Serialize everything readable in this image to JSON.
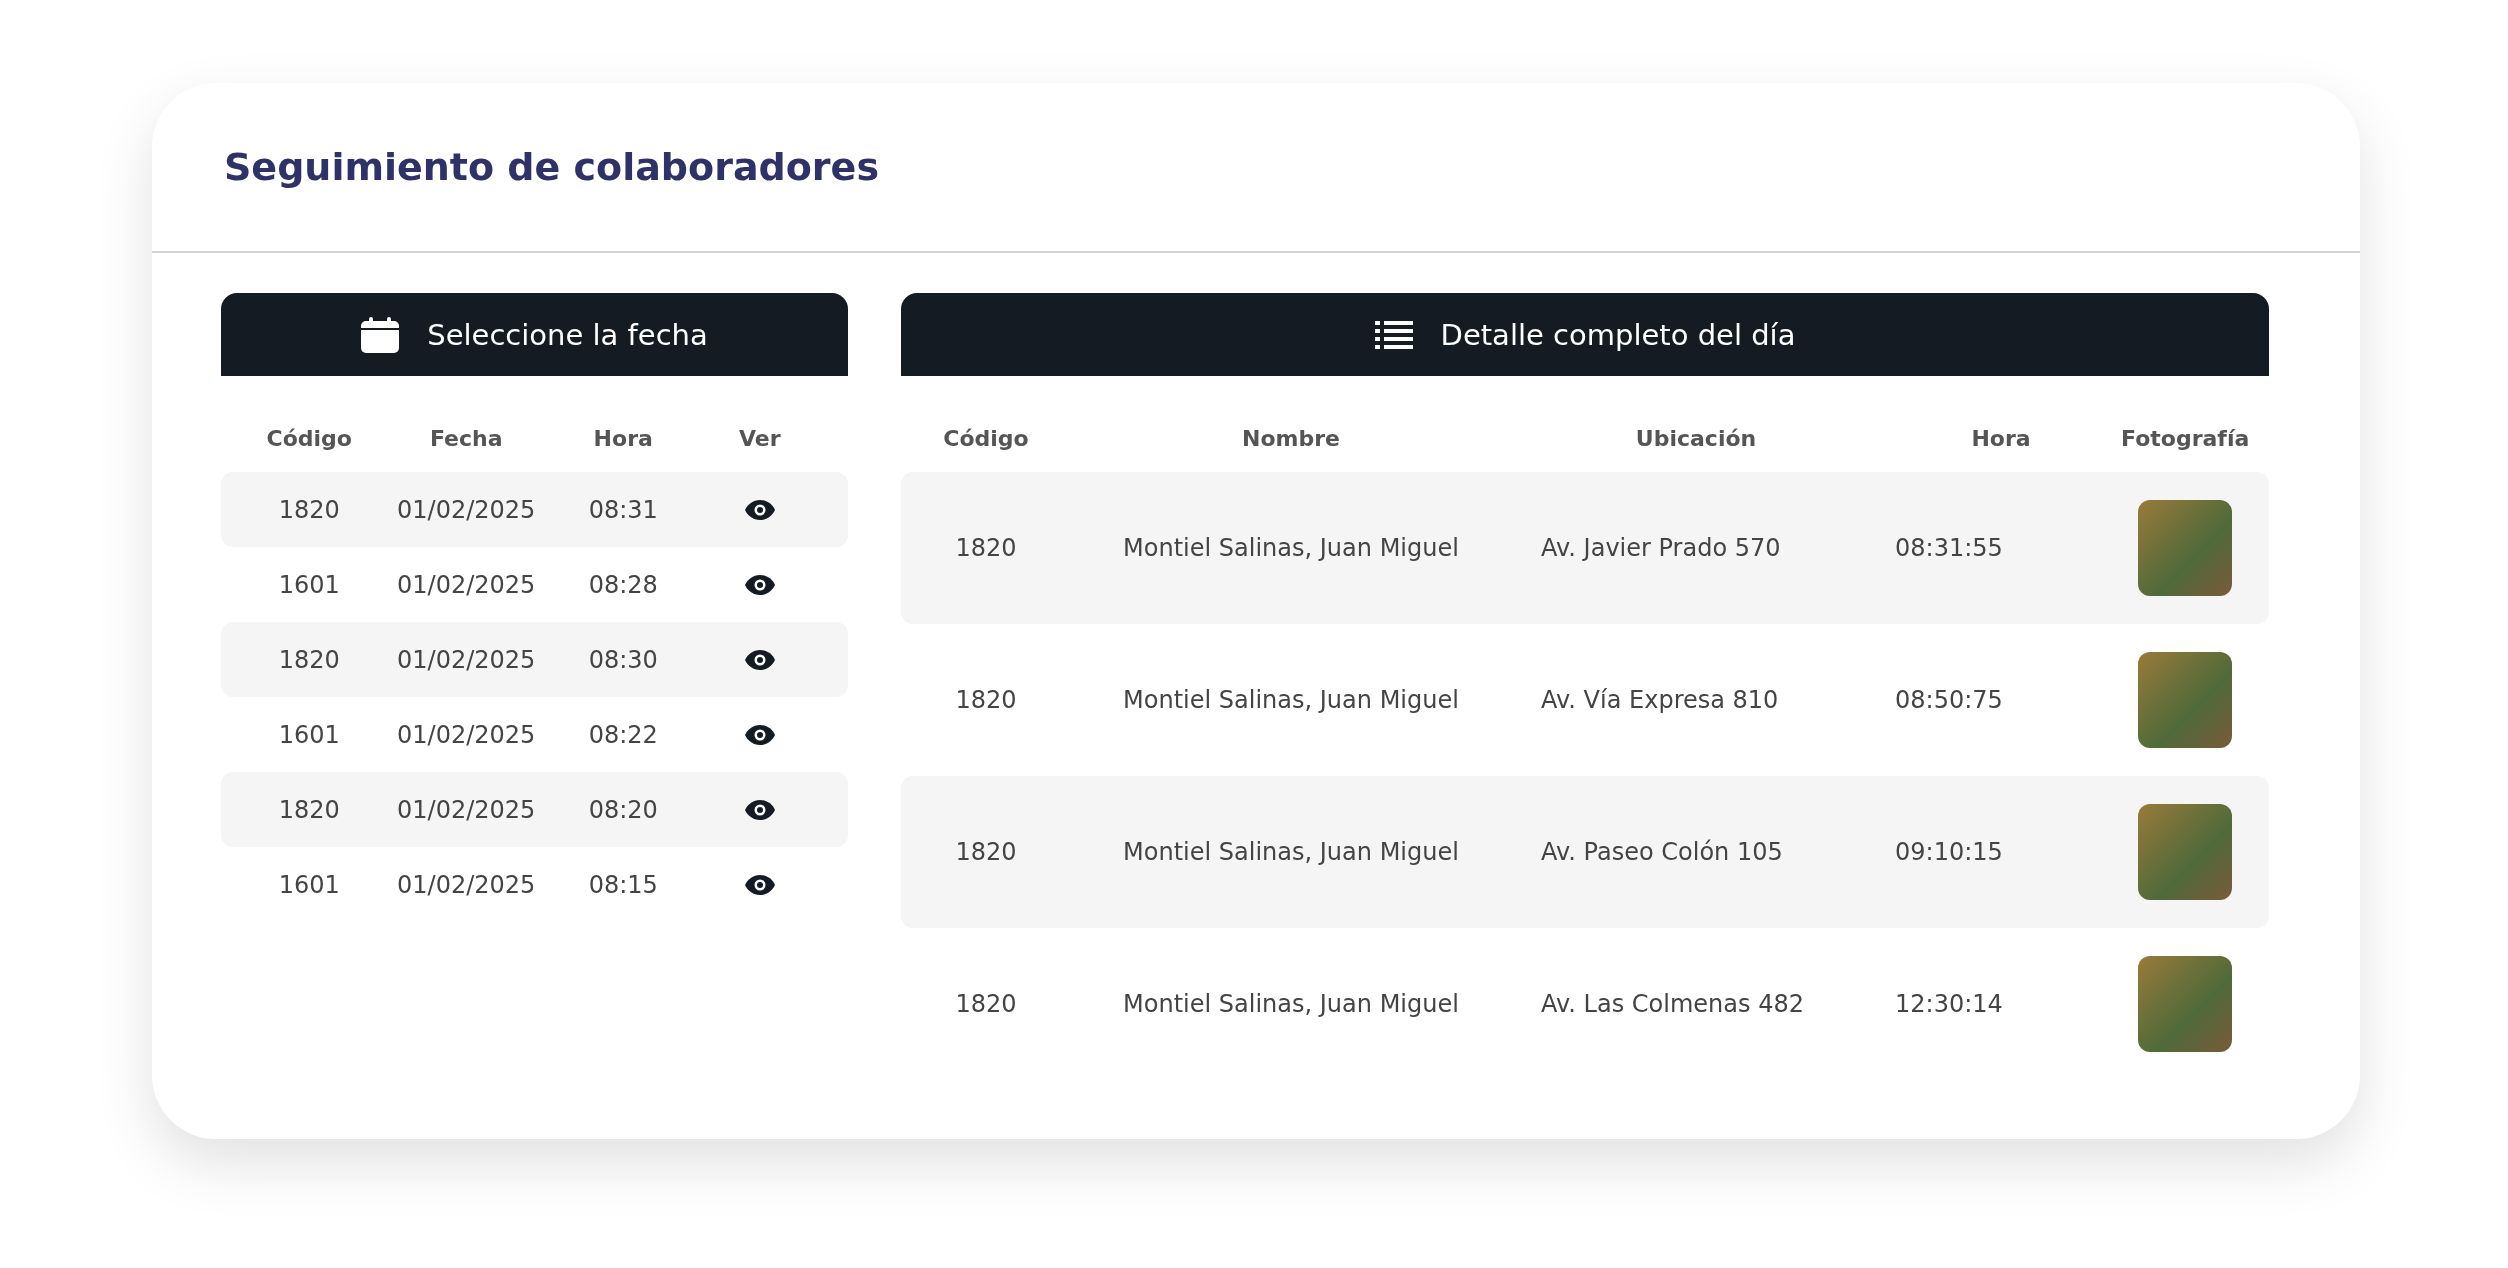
{
  "title": "Seguimiento de colaboradores",
  "date_panel": {
    "header": "Seleccione la fecha",
    "columns": [
      "Código",
      "Fecha",
      "Hora",
      "Ver"
    ],
    "rows": [
      {
        "code": "1820",
        "date": "01/02/2025",
        "time": "08:31"
      },
      {
        "code": "1601",
        "date": "01/02/2025",
        "time": "08:28"
      },
      {
        "code": "1820",
        "date": "01/02/2025",
        "time": "08:30"
      },
      {
        "code": "1601",
        "date": "01/02/2025",
        "time": "08:22"
      },
      {
        "code": "1820",
        "date": "01/02/2025",
        "time": "08:20"
      },
      {
        "code": "1601",
        "date": "01/02/2025",
        "time": "08:15"
      }
    ]
  },
  "detail_panel": {
    "header": "Detalle completo del día",
    "columns": [
      "Código",
      "Nombre",
      "Ubicación",
      "Hora",
      "Fotografía"
    ],
    "rows": [
      {
        "code": "1820",
        "name": "Montiel Salinas, Juan Miguel",
        "location": "Av. Javier Prado 570",
        "time": "08:31:55"
      },
      {
        "code": "1820",
        "name": "Montiel Salinas, Juan Miguel",
        "location": "Av. Vía Expresa 810",
        "time": "08:50:75"
      },
      {
        "code": "1820",
        "name": "Montiel Salinas, Juan Miguel",
        "location": "Av. Paseo Colón 105",
        "time": "09:10:15"
      },
      {
        "code": "1820",
        "name": "Montiel Salinas, Juan Miguel",
        "location": "Av. Las Colmenas 482",
        "time": "12:30:14"
      }
    ]
  }
}
